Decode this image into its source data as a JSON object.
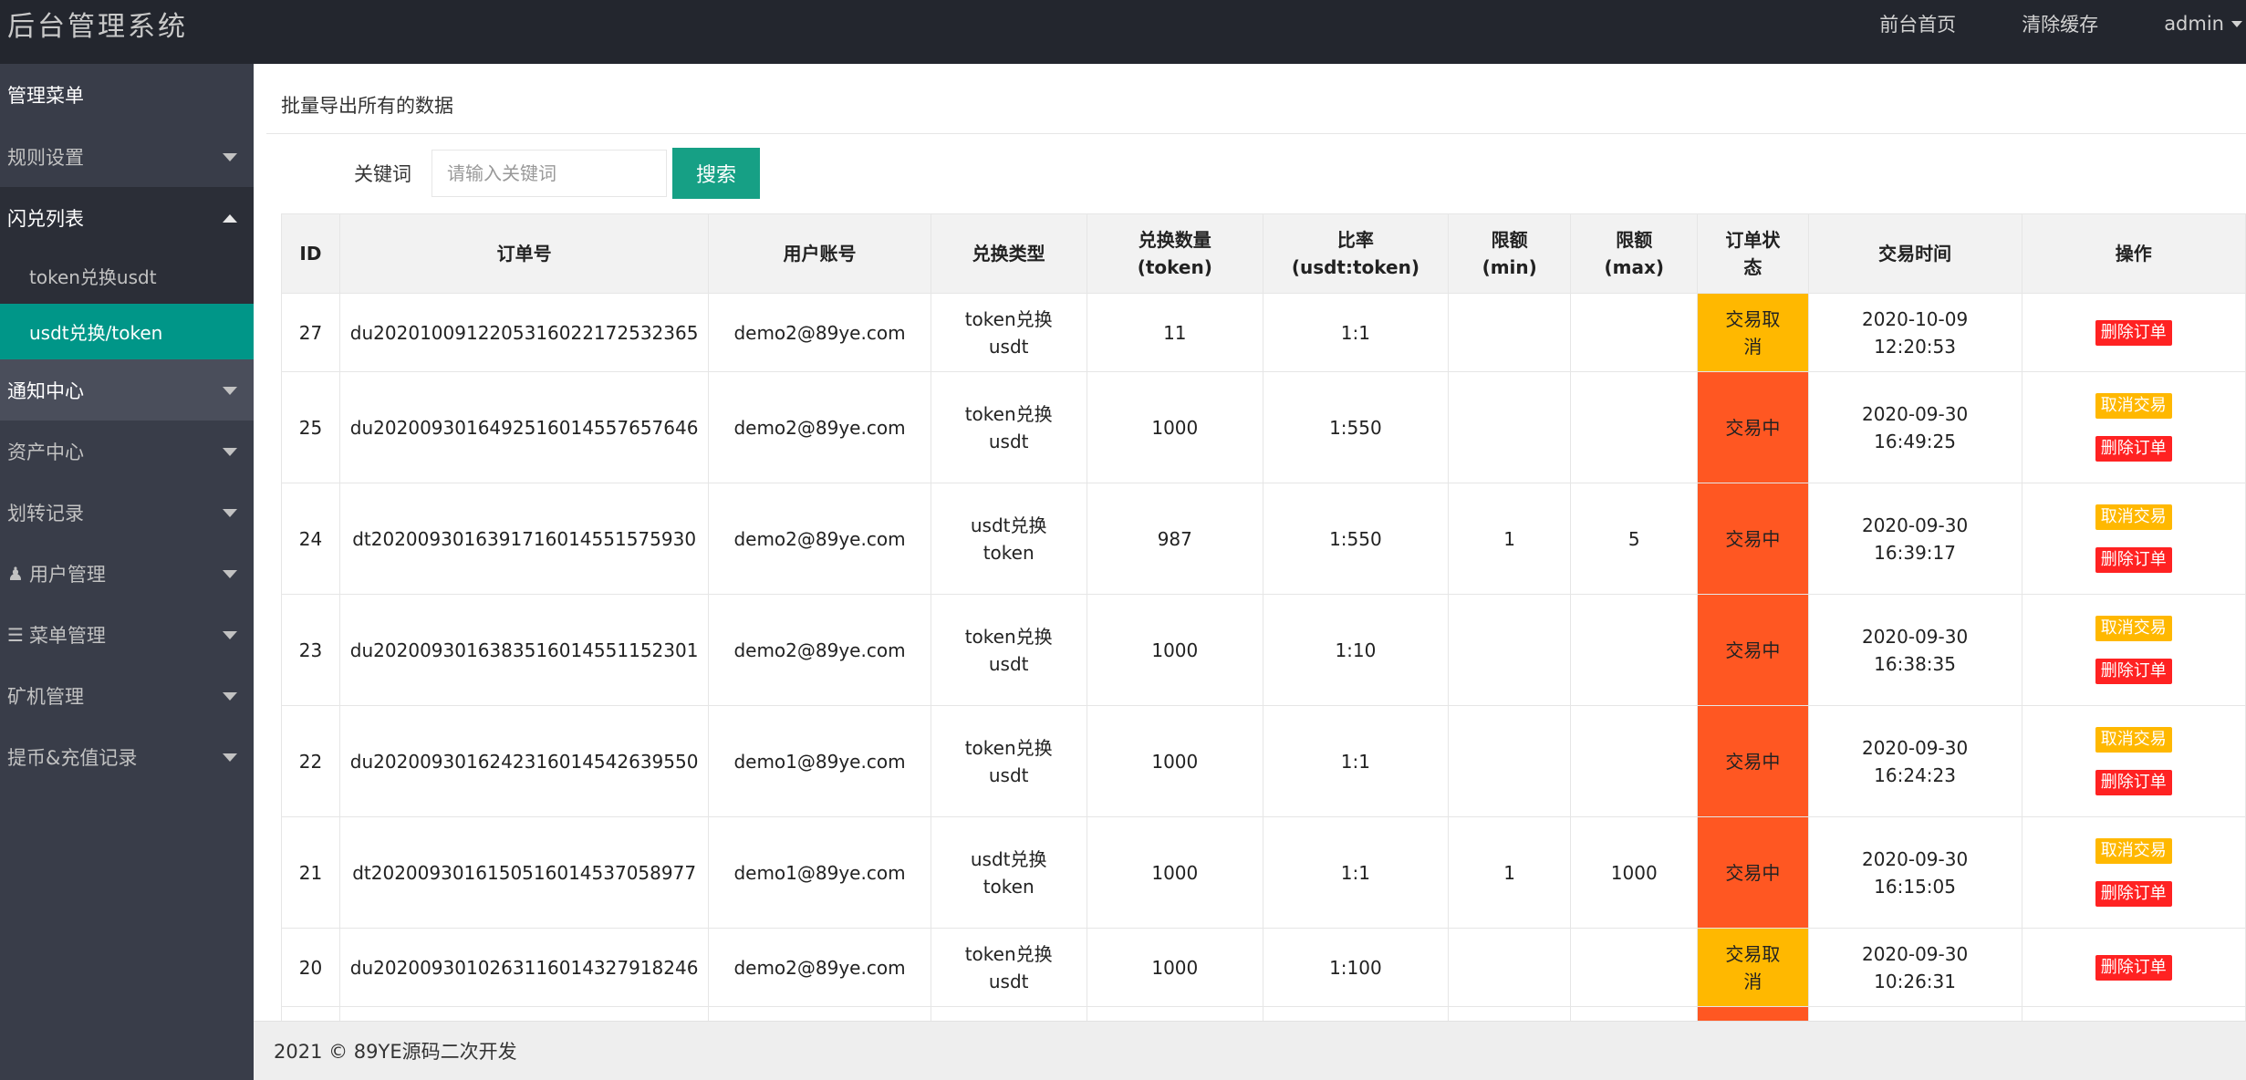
{
  "header": {
    "title": "后台管理系统",
    "nav": [
      "前台首页",
      "清除缓存",
      "admin"
    ]
  },
  "sidebar": {
    "heading": "管理菜单",
    "items": [
      {
        "label": "规则设置",
        "icon": "",
        "expanded": false
      },
      {
        "label": "闪兑列表",
        "icon": "",
        "expanded": true,
        "children": [
          {
            "label": "token兑换usdt",
            "active": false
          },
          {
            "label": "usdt兑换/token",
            "active": true
          }
        ]
      },
      {
        "label": "通知中心",
        "icon": "",
        "expanded": false
      },
      {
        "label": "资产中心",
        "icon": "",
        "expanded": false
      },
      {
        "label": "划转记录",
        "icon": "",
        "expanded": false
      },
      {
        "label": "用户管理",
        "icon": "users-icon",
        "expanded": false
      },
      {
        "label": "菜单管理",
        "icon": "list-icon",
        "expanded": false
      },
      {
        "label": "矿机管理",
        "icon": "",
        "expanded": false
      },
      {
        "label": "提币&充值记录",
        "icon": "",
        "expanded": false
      }
    ]
  },
  "panel": {
    "title": "批量导出所有的数据",
    "search_label": "关键词",
    "search_placeholder": "请输入关键词",
    "search_button": "搜索"
  },
  "table": {
    "headers": [
      [
        "ID"
      ],
      [
        "订单号"
      ],
      [
        "用户账号"
      ],
      [
        "兑换类型"
      ],
      [
        "兑换数量",
        "(token)"
      ],
      [
        "比率",
        "(usdt:token)"
      ],
      [
        "限额",
        "(min)"
      ],
      [
        "限额",
        "(max)"
      ],
      [
        "订单状",
        "态"
      ],
      [
        "交易时间"
      ],
      [
        "操作"
      ]
    ],
    "rows": [
      {
        "id": "27",
        "order": "du20201009122053160221725323​65",
        "account": "demo2@89ye.com",
        "type": [
          "token兑换",
          "usdt"
        ],
        "amount": "11",
        "ratio": "1:1",
        "min": "",
        "max": "",
        "status": [
          "交易取",
          "消"
        ],
        "status_kind": "cancel",
        "time": [
          "2020-10-09",
          "12:20:53"
        ],
        "actions": [
          "删除订单"
        ]
      },
      {
        "id": "25",
        "order": "du20200930164925160145576576​46",
        "account": "demo2@89ye.com",
        "type": [
          "token兑换",
          "usdt"
        ],
        "amount": "1000",
        "ratio": "1:550",
        "min": "",
        "max": "",
        "status": [
          "交易中"
        ],
        "status_kind": "trading",
        "time": [
          "2020-09-30",
          "16:49:25"
        ],
        "actions": [
          "取消交易",
          "删除订单"
        ]
      },
      {
        "id": "24",
        "order": "dt20200930163917160145515759​30",
        "account": "demo2@89ye.com",
        "type": [
          "usdt兑换",
          "token"
        ],
        "amount": "987",
        "ratio": "1:550",
        "min": "1",
        "max": "5",
        "status": [
          "交易中"
        ],
        "status_kind": "trading",
        "time": [
          "2020-09-30",
          "16:39:17"
        ],
        "actions": [
          "取消交易",
          "删除订单"
        ]
      },
      {
        "id": "23",
        "order": "du20200930163835160145511523​01",
        "account": "demo2@89ye.com",
        "type": [
          "token兑换",
          "usdt"
        ],
        "amount": "1000",
        "ratio": "1:10",
        "min": "",
        "max": "",
        "status": [
          "交易中"
        ],
        "status_kind": "trading",
        "time": [
          "2020-09-30",
          "16:38:35"
        ],
        "actions": [
          "取消交易",
          "删除订单"
        ]
      },
      {
        "id": "22",
        "order": "du20200930162423160145426395​50",
        "account": "demo1@89ye.com",
        "type": [
          "token兑换",
          "usdt"
        ],
        "amount": "1000",
        "ratio": "1:1",
        "min": "",
        "max": "",
        "status": [
          "交易中"
        ],
        "status_kind": "trading",
        "time": [
          "2020-09-30",
          "16:24:23"
        ],
        "actions": [
          "取消交易",
          "删除订单"
        ]
      },
      {
        "id": "21",
        "order": "dt20200930161505160145370589​77",
        "account": "demo1@89ye.com",
        "type": [
          "usdt兑换",
          "token"
        ],
        "amount": "1000",
        "ratio": "1:1",
        "min": "1",
        "max": "1000",
        "status": [
          "交易中"
        ],
        "status_kind": "trading",
        "time": [
          "2020-09-30",
          "16:15:05"
        ],
        "actions": [
          "取消交易",
          "删除订单"
        ]
      },
      {
        "id": "20",
        "order": "du20200930102631160143279182​46",
        "account": "demo2@89ye.com",
        "type": [
          "token兑换",
          "usdt"
        ],
        "amount": "1000",
        "ratio": "1:100",
        "min": "",
        "max": "",
        "status": [
          "交易取",
          "消"
        ],
        "status_kind": "cancel",
        "time": [
          "2020-09-30",
          "10:26:31"
        ],
        "actions": [
          "删除订单"
        ]
      },
      {
        "id": "",
        "order": "",
        "account": "",
        "type": [
          ""
        ],
        "amount": "",
        "ratio": "",
        "min": "",
        "max": "",
        "status": [
          ""
        ],
        "status_kind": "trading",
        "time": [
          ""
        ],
        "actions": []
      }
    ]
  },
  "footer": {
    "text": "2021 © 89YE源码二次开发"
  },
  "colors": {
    "header_bg": "#23262e",
    "sidebar_bg": "#393d49",
    "active": "#009688",
    "search_btn": "#16a085",
    "cancel": "#ffb800",
    "trading": "#ff5722",
    "delete": "#ff2222"
  }
}
